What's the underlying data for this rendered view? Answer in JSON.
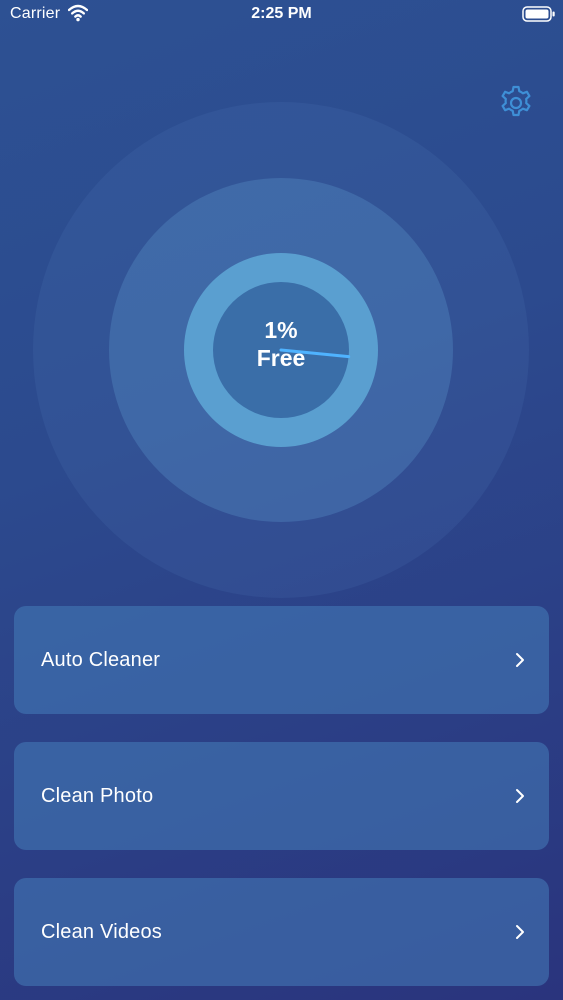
{
  "status_bar": {
    "carrier": "Carrier",
    "time": "2:25 PM"
  },
  "icons": {
    "settings": "gear-icon",
    "wifi": "wifi-icon",
    "battery": "battery-icon",
    "chevron": "chevron-right-icon"
  },
  "storage": {
    "percent_label": "1%",
    "free_label": "Free",
    "free_fraction": 0.01
  },
  "menu": {
    "items": [
      {
        "label": "Auto Cleaner"
      },
      {
        "label": "Clean Photo"
      },
      {
        "label": "Clean Videos"
      }
    ]
  },
  "colors": {
    "background_top": "#2d5193",
    "background_bottom": "#2a347d",
    "ring_accent": "#5a9fd0",
    "gauge_center": "#3a6ea8",
    "arc_accent": "#4fb3ff",
    "card_fill": "#4a7db9",
    "gear_color": "#3e8fd6"
  }
}
